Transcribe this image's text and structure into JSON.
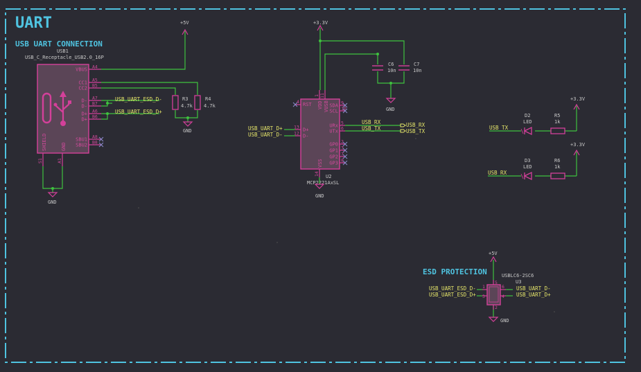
{
  "sheet": {
    "title": "UART",
    "sections": {
      "usb": "USB UART CONNECTION",
      "esd": "ESD PROTECTION"
    }
  },
  "power": {
    "p5v": "+5V",
    "p3v3": "+3.3V",
    "gnd": "GND"
  },
  "usb1": {
    "ref": "USB1",
    "value": "USB_C_Receptacle_USB2.0_16P",
    "pins_right": [
      {
        "name": "VBUS",
        "num": "A4"
      },
      {
        "name": "CC1",
        "num": "A5"
      },
      {
        "name": "CC2",
        "num": "B5"
      },
      {
        "name": "D-",
        "num": "A7"
      },
      {
        "name": "D-",
        "num": "B7"
      },
      {
        "name": "D+",
        "num": "A6"
      },
      {
        "name": "D+",
        "num": "B6"
      },
      {
        "name": "SBU1",
        "num": "A8"
      },
      {
        "name": "SBU2",
        "num": "B8"
      }
    ],
    "pins_bottom": [
      {
        "name": "SHIELD",
        "num": "S1"
      },
      {
        "name": "GND",
        "num": "A1"
      }
    ]
  },
  "resistors": {
    "r3": {
      "ref": "R3",
      "value": "4.7k"
    },
    "r4": {
      "ref": "R4",
      "value": "4.7k"
    },
    "r5": {
      "ref": "R5",
      "value": "1k"
    },
    "r6": {
      "ref": "R6",
      "value": "1k"
    }
  },
  "caps": {
    "c6": {
      "ref": "C6",
      "value": "10n"
    },
    "c7": {
      "ref": "C7",
      "value": "10n"
    }
  },
  "leds": {
    "d2": {
      "ref": "D2",
      "value": "LED"
    },
    "d3": {
      "ref": "D3",
      "value": "LED"
    }
  },
  "u2": {
    "ref": "U2",
    "value": "MCP2221AxSL",
    "pins_top": [
      {
        "name": "VDD",
        "num": "1"
      },
      {
        "name": "VUSB",
        "num": "11"
      }
    ],
    "pin_rst": {
      "name": "RST",
      "num": "4"
    },
    "pins_left": [
      {
        "name": "D+",
        "num": "13"
      },
      {
        "name": "D-",
        "num": "12"
      }
    ],
    "pins_right": [
      {
        "name": "SDA",
        "num": "9"
      },
      {
        "name": "SCL",
        "num": "10"
      },
      {
        "name": "URx",
        "num": "5"
      },
      {
        "name": "UTx",
        "num": "6"
      },
      {
        "name": "GP0",
        "num": "2"
      },
      {
        "name": "GP1",
        "num": "3"
      },
      {
        "name": "GP2",
        "num": "7"
      },
      {
        "name": "GP3",
        "num": "8"
      }
    ],
    "pin_vss": {
      "name": "VSS",
      "num": "14"
    }
  },
  "u3": {
    "ref": "U3",
    "value": "USBLC6-2SC6",
    "pins": {
      "l_top": "1",
      "l_bot": "3",
      "r_top": "6",
      "r_bot": "4",
      "top": "5",
      "bot": "2"
    }
  },
  "nets": {
    "usb_dm_esd": "USB_UART_ESD_D-",
    "usb_dp_esd": "USB_UART_ESD_D+",
    "usb_dp": "USB_UART_D+",
    "usb_dm": "USB_UART_D-",
    "usb_rx": "USB_RX",
    "usb_tx": "USB_TX"
  }
}
